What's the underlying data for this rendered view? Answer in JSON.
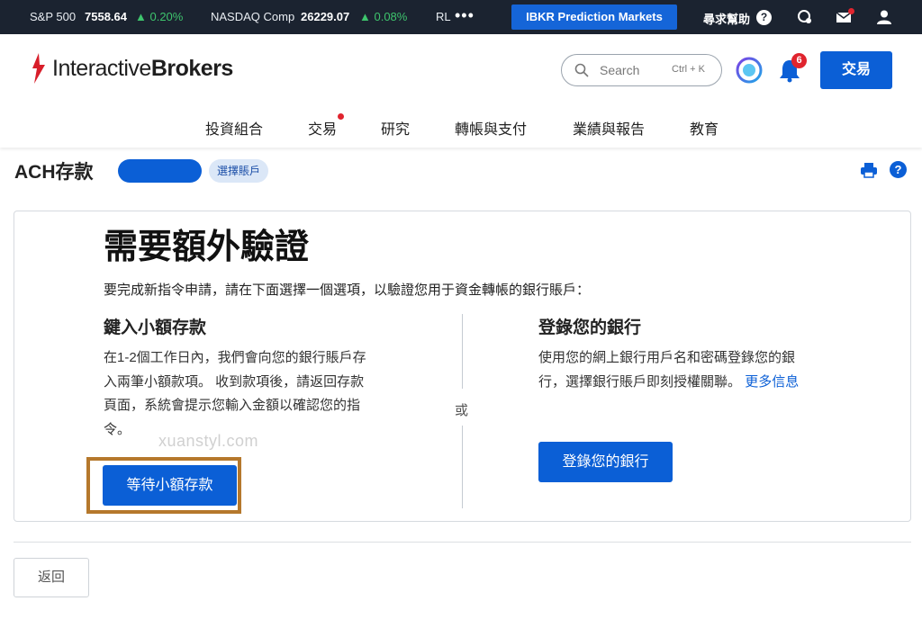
{
  "ticker": {
    "items": [
      {
        "symbol": "S&P 500",
        "value": "7558.64",
        "change": "▲ 0.20%"
      },
      {
        "symbol": "NASDAQ Comp",
        "value": "26229.07",
        "change": "▲ 0.08%"
      },
      {
        "symbol": "RL",
        "value": "",
        "change": ""
      }
    ],
    "more_label": "•••",
    "prediction_markets_label": "IBKR Prediction Markets",
    "help_label": "尋求幫助",
    "help_icon": "?"
  },
  "header": {
    "logo_main": "Interactive",
    "logo_bold": "Brokers",
    "search_placeholder": "Search",
    "search_shortcut": "Ctrl + K",
    "notification_count": "6",
    "trade_button": "交易",
    "nav": [
      "投資組合",
      "交易",
      "研究",
      "轉帳與支付",
      "業績與報告",
      "教育"
    ]
  },
  "page": {
    "title": "ACH存款",
    "select_account": "選擇賬戶",
    "help_icon": "?"
  },
  "verification": {
    "heading": "需要額外驗證",
    "intro": "要完成新指令申請，請在下面選擇一個選項，以驗證您用于資金轉帳的銀行賬戶：",
    "or_label": "或",
    "left": {
      "title": "鍵入小額存款",
      "lines": [
        "在1-2個工作日內，我們會向您的銀行賬戶存",
        "入兩筆小額款項。 收到款項後，請返回存款",
        "頁面，系統會提示您輸入金額以確認您的指",
        "令。"
      ],
      "button": "等待小額存款"
    },
    "right": {
      "title": "登錄您的銀行",
      "line1": "使用您的網上銀行用戶名和密碼登錄您的銀",
      "line2": "行，選擇銀行賬戶即刻授權關聯。",
      "more_link": "更多信息",
      "button": "登錄您的銀行"
    }
  },
  "watermark": "xuanstyl.com",
  "footer": {
    "back_button": "返回"
  },
  "colors": {
    "primary": "#0b5fd6",
    "ticker_bg": "#1b2330",
    "positive": "#3ec46d",
    "alert": "#e0242e",
    "highlight_border": "#b5782c"
  }
}
